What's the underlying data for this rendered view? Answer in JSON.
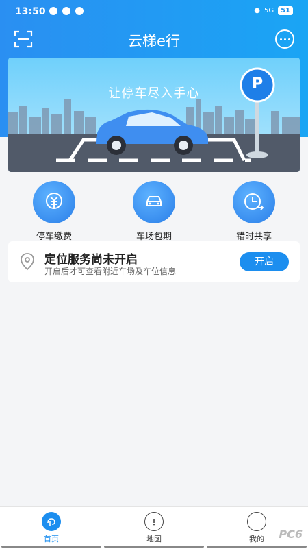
{
  "status_bar": {
    "time": "13:50",
    "network": "5G",
    "battery": "51"
  },
  "header": {
    "title": "云梯e行"
  },
  "banner": {
    "slogan": "让停车尽入手心",
    "parking_sign": "P"
  },
  "quick_actions": [
    {
      "label": "停车缴费",
      "icon": "yen-payment-icon"
    },
    {
      "label": "车场包期",
      "icon": "car-icon"
    },
    {
      "label": "错时共享",
      "icon": "clock-share-icon"
    }
  ],
  "location_card": {
    "title": "定位服务尚未开启",
    "subtitle": "开启后才可查看附近车场及车位信息",
    "button": "开启"
  },
  "tabbar": {
    "items": [
      {
        "label": "首页",
        "active": true
      },
      {
        "label": "地图",
        "active": false
      },
      {
        "label": "我的",
        "active": false
      }
    ]
  },
  "watermark": "PC6",
  "colors": {
    "primary": "#1c8eef",
    "header": "#2a8ff2"
  }
}
